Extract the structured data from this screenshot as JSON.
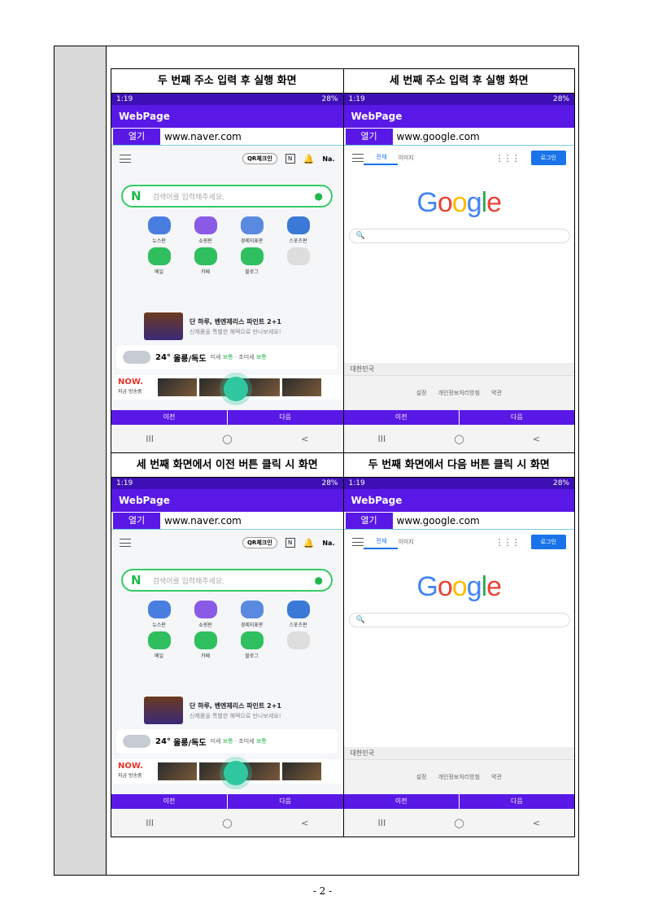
{
  "panels": [
    {
      "caption": "두 번째 주소 입력 후 실행 화면",
      "site": "naver",
      "url": "www.naver.com"
    },
    {
      "caption": "세 번째 주소 입력 후 실행 화면",
      "site": "google",
      "url": "www.google.com"
    },
    {
      "caption": "세 번째 화면에서 이전 버튼 클릭 시 화면",
      "site": "naver",
      "url": "www.naver.com"
    },
    {
      "caption": "두 번째 화면에서 다음 버튼 클릭 시 화면",
      "site": "google",
      "url": "www.google.com"
    }
  ],
  "phone": {
    "status_time": "1:19",
    "status_right": "28%",
    "app_title": "WebPage",
    "open_label": "열기",
    "prev_label": "이전",
    "next_label": "다음",
    "sys_recent": "III",
    "sys_home": "◯",
    "sys_back": "<"
  },
  "naver": {
    "qr_label": "QR체크인",
    "n_badge": "N",
    "user_label": "Na.",
    "logo": "N",
    "search_placeholder": "검색어를 입력해주세요.",
    "shortcuts": [
      "뉴스판",
      "쇼핑판",
      "경제지표판",
      "스포츠판",
      "메일",
      "카페",
      "블로그",
      ""
    ],
    "shortcut_colors": [
      "#4a7de0",
      "#8a5ae6",
      "#5a8ae0",
      "#3a7ad6",
      "#2fbf5f",
      "#2fbf5f",
      "#2fbf5f",
      "#dddddd"
    ],
    "ad_title": "단 하루, 벤엔제리스 파인트 2+1",
    "ad_sub": "신제품을 특별한 혜택으로 만나보세요!",
    "weather_temp": "24°",
    "weather_loc": "울릉/독도",
    "weather_fine_label": "미세",
    "weather_fine_value": "보통",
    "weather_ultra_label": "· 초미세",
    "weather_ultra_value": "보통",
    "now_label": "NOW.",
    "now_sub": "지금 방송중"
  },
  "google": {
    "tab_all": "전체",
    "tab_images": "이미지",
    "login_label": "로그인",
    "logo_letters": [
      {
        "ch": "G",
        "color": "#4285f4"
      },
      {
        "ch": "o",
        "color": "#ea4335"
      },
      {
        "ch": "o",
        "color": "#fbbc05"
      },
      {
        "ch": "g",
        "color": "#4285f4"
      },
      {
        "ch": "l",
        "color": "#34a853"
      },
      {
        "ch": "e",
        "color": "#ea4335"
      }
    ],
    "country": "대한민국",
    "footer_links": [
      "설정",
      "개인정보처리방침",
      "약관"
    ]
  },
  "page_number": "- 2 -"
}
